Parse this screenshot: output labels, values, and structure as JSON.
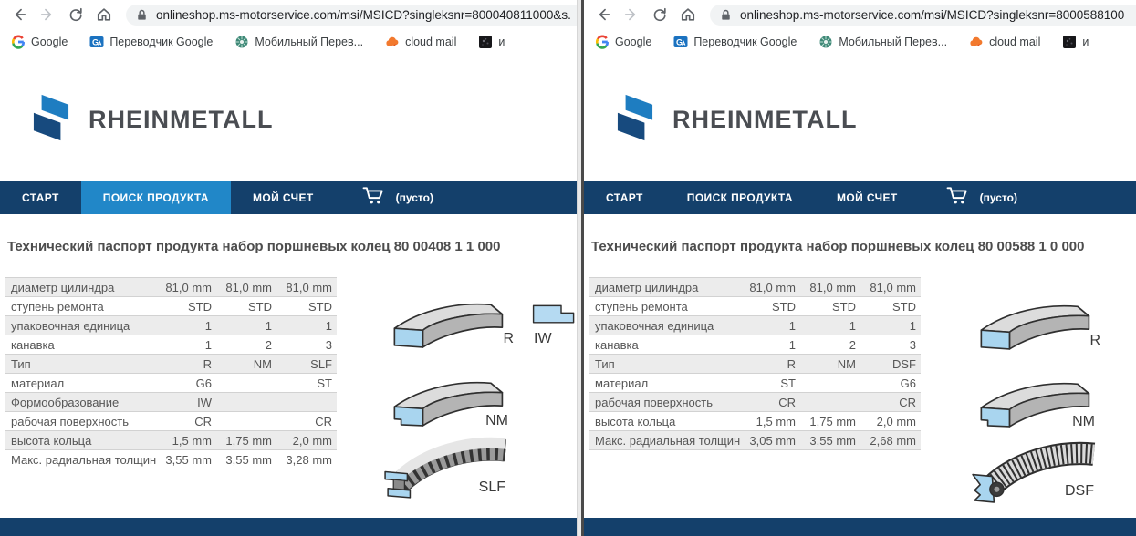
{
  "colors": {
    "navy": "#14406b",
    "active_nav_blue": "#2187c8",
    "logo_light_blue": "#1e7dc1",
    "logo_dark_blue": "#174a7e",
    "table_stripe": "#ececec",
    "ring_blue": "#a9d5ef"
  },
  "windows": [
    {
      "browser": {
        "url": "onlineshop.ms-motorservice.com/msi/MSICD?singleksnr=800040811000&s.",
        "bookmarks": [
          {
            "label": "Google",
            "icon": "google-g-icon"
          },
          {
            "label": "Переводчик Google",
            "icon": "google-translate-icon"
          },
          {
            "label": "Мобильный Перев...",
            "icon": "mobile-translator-icon"
          },
          {
            "label": "cloud mail",
            "icon": "cloud-mail-icon"
          },
          {
            "label": "и",
            "icon": "dark-thumbnail-icon"
          }
        ]
      },
      "site": {
        "brand": "RHEINMETALL",
        "nav": [
          {
            "label": "СТАРТ",
            "active": false
          },
          {
            "label": "ПОИСК ПРОДУКТА",
            "active": true
          },
          {
            "label": "МОЙ СЧЕТ",
            "active": false
          }
        ],
        "cart_label": "(пусто)",
        "title": "Технический паспорт продукта набор поршневых колец 80 00408 1 1 000",
        "table": {
          "rows": [
            {
              "label": "диаметр цилиндра",
              "values": [
                "81,0 mm",
                "81,0 mm",
                "81,0 mm"
              ]
            },
            {
              "label": "ступень ремонта",
              "values": [
                "STD",
                "STD",
                "STD"
              ]
            },
            {
              "label": "упаковочная единица",
              "values": [
                "1",
                "1",
                "1"
              ]
            },
            {
              "label": "канавка",
              "values": [
                "1",
                "2",
                "3"
              ]
            },
            {
              "label": "Тип",
              "values": [
                "R",
                "NM",
                "SLF"
              ]
            },
            {
              "label": "материал",
              "values": [
                "G6",
                "",
                "ST"
              ]
            },
            {
              "label": "Формообразование",
              "values": [
                "IW",
                "",
                ""
              ]
            },
            {
              "label": "рабочая поверхность",
              "values": [
                "CR",
                "",
                "CR"
              ]
            },
            {
              "label": "высота кольца",
              "values": [
                "1,5 mm",
                "1,75 mm",
                "2,0 mm"
              ]
            },
            {
              "label": "Макс. радиальная толщина",
              "values": [
                "3,55 mm",
                "3,55 mm",
                "3,28 mm"
              ]
            }
          ]
        },
        "ring_images": [
          {
            "type": "ring-r",
            "label": "R"
          },
          {
            "type": "ring-iw",
            "label": "IW"
          },
          {
            "type": "ring-nm",
            "label": "NM"
          },
          {
            "type": "ring-slf",
            "label": "SLF"
          }
        ]
      }
    },
    {
      "browser": {
        "url": "onlineshop.ms-motorservice.com/msi/MSICD?singleksnr=8000588100",
        "bookmarks": [
          {
            "label": "Google",
            "icon": "google-g-icon"
          },
          {
            "label": "Переводчик Google",
            "icon": "google-translate-icon"
          },
          {
            "label": "Мобильный Перев...",
            "icon": "mobile-translator-icon"
          },
          {
            "label": "cloud mail",
            "icon": "cloud-mail-icon"
          },
          {
            "label": "и",
            "icon": "dark-thumbnail-icon"
          }
        ]
      },
      "site": {
        "brand": "RHEINMETALL",
        "nav": [
          {
            "label": "СТАРТ",
            "active": false
          },
          {
            "label": "ПОИСК ПРОДУКТА",
            "active": false
          },
          {
            "label": "МОЙ СЧЕТ",
            "active": false
          }
        ],
        "cart_label": "(пусто)",
        "title": "Технический паспорт продукта набор поршневых колец 80 00588 1 0 000",
        "table": {
          "rows": [
            {
              "label": "диаметр цилиндра",
              "values": [
                "81,0 mm",
                "81,0 mm",
                "81,0 mm"
              ]
            },
            {
              "label": "ступень ремонта",
              "values": [
                "STD",
                "STD",
                "STD"
              ]
            },
            {
              "label": "упаковочная единица",
              "values": [
                "1",
                "1",
                "1"
              ]
            },
            {
              "label": "канавка",
              "values": [
                "1",
                "2",
                "3"
              ]
            },
            {
              "label": "Тип",
              "values": [
                "R",
                "NM",
                "DSF"
              ]
            },
            {
              "label": "материал",
              "values": [
                "ST",
                "",
                "G6"
              ]
            },
            {
              "label": "рабочая поверхность",
              "values": [
                "CR",
                "",
                "CR"
              ]
            },
            {
              "label": "высота кольца",
              "values": [
                "1,5 mm",
                "1,75 mm",
                "2,0 mm"
              ]
            },
            {
              "label": "Макс. радиальная толщина",
              "values": [
                "3,05 mm",
                "3,55 mm",
                "2,68 mm"
              ]
            }
          ]
        },
        "ring_images": [
          {
            "type": "ring-r",
            "label": "R"
          },
          {
            "type": "ring-nm",
            "label": "NM"
          },
          {
            "type": "ring-dsf",
            "label": "DSF"
          }
        ]
      }
    }
  ]
}
